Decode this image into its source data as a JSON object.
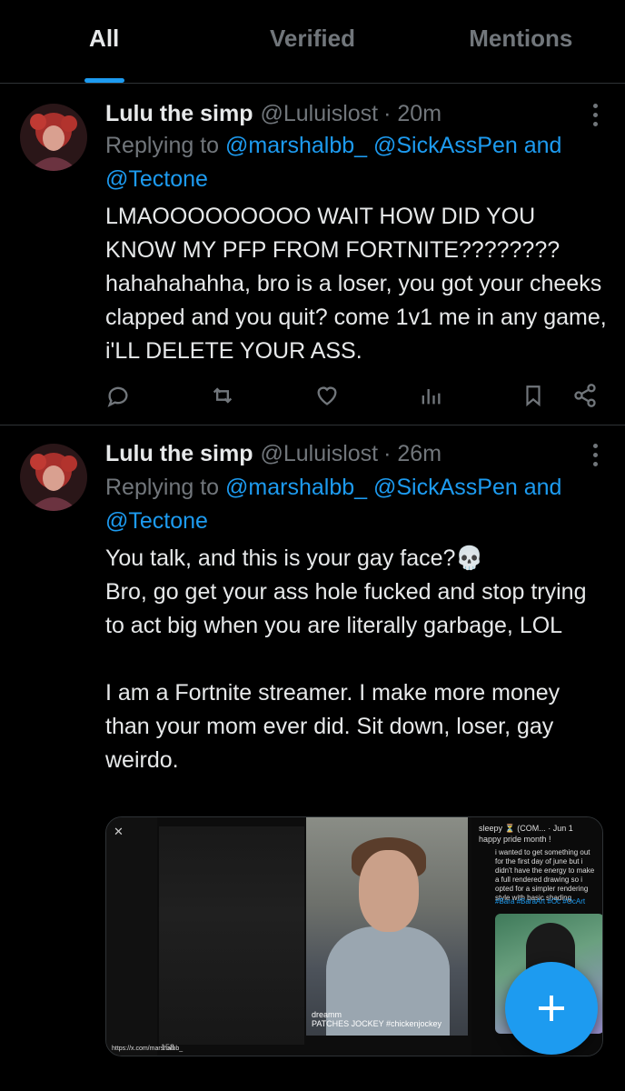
{
  "tabs": [
    {
      "label": "All",
      "active": true
    },
    {
      "label": "Verified",
      "active": false
    },
    {
      "label": "Mentions",
      "active": false
    }
  ],
  "tweets": [
    {
      "name": "Lulu the simp",
      "handle": "@Luluislost",
      "time": "· 20m",
      "replying_prefix": "Replying to",
      "mentions": "@marshalbb_ @SickAssPen and",
      "mentions_line2": "@Tectone",
      "text": "LMAOOOOOOOOO WAIT HOW DID YOU KNOW MY PFP FROM FORTNITE???????? hahahahahha, bro is a loser, you got your cheeks clapped and you quit? come 1v1 me in any game, i'LL DELETE YOUR ASS."
    },
    {
      "name": "Lulu the simp",
      "handle": "@Luluislost",
      "time": "· 26m",
      "replying_prefix": "Replying to",
      "mentions": "@marshalbb_ @SickAssPen and",
      "mentions_line2": "@Tectone",
      "text_p1": "You talk, and this is your gay face?💀",
      "text_p2": "Bro, go get your ass hole fucked and stop trying to act big when you are literally garbage, LOL",
      "text_p3": "I am a Fortnite streamer. I make more money than your mom ever did. Sit down, loser, gay weirdo.",
      "media": {
        "video_caption": "dreamm",
        "video_subcaption": "PATCHES JOCKEY #chickenjockey",
        "url": "https://x.com/marshalbb_",
        "right_user": "sleepy ⏳ (COM...",
        "right_date": "· Jun 1",
        "right_title": "happy pride month !",
        "right_text": "i wanted to get something out for the first day of june but i didn't have the energy to make a full rendered drawing so i opted for a simpler rendering style with basic shading",
        "right_tags": "#Bara #BaraArt #Oc #OcArt",
        "bottom_count": "158"
      }
    }
  ],
  "colors": {
    "accent": "#1d9bf0",
    "muted": "#71767b",
    "text": "#e7e9ea",
    "bg": "#000000"
  }
}
